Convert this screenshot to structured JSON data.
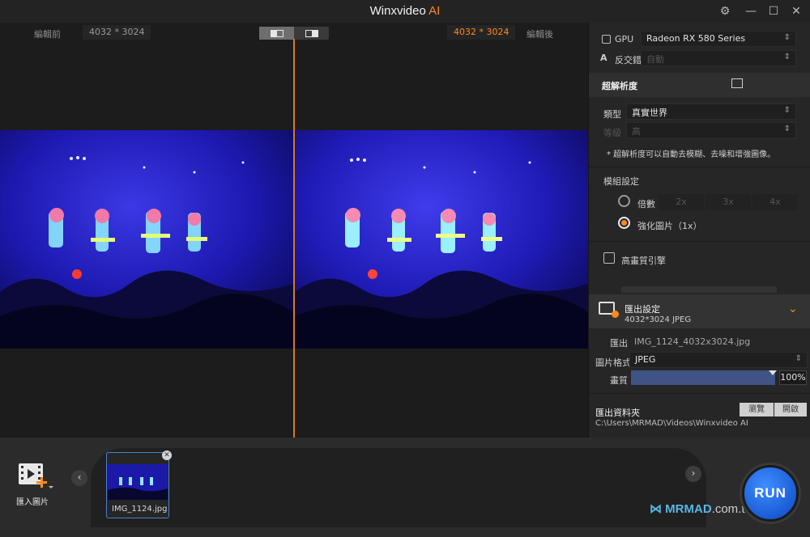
{
  "titlebar": {
    "title_main": "Winxvideo",
    "title_ai": "AI",
    "controls": [
      "gear-icon",
      "minimize-icon",
      "maximize-icon",
      "close-icon"
    ]
  },
  "preview": {
    "before_label": "編輯前",
    "before_resolution": "4032 * 3024",
    "after_resolution": "4032 * 3024",
    "after_label": "編輯後"
  },
  "panel": {
    "gpu_label": "GPU",
    "gpu_value": "Radeon RX 580 Series",
    "anti_alias_label": "反交錯",
    "anti_alias_value": "自動",
    "super_res_title": "超解析度",
    "type_label": "類型",
    "type_value": "真實世界",
    "level_label": "等級",
    "level_value": "高",
    "note": "* 超解析度可以自動去模糊、去噪和增強圖像。",
    "module_title": "模組設定",
    "multiplier_label": "倍數",
    "multipliers": [
      "2x",
      "3x",
      "4x"
    ],
    "enhance_label": "強化圖片（1x）",
    "hq_engine_label": "高畫質引擎",
    "export_title": "匯出設定",
    "export_sub": "4032*3024  JPEG",
    "export_label": "匯出",
    "export_file": "IMG_1124_4032x3024.jpg",
    "format_label": "圖片格式",
    "format_value": "JPEG",
    "quality_label": "畫質",
    "quality_value": "100%",
    "folder_title": "匯出資料夾",
    "browse_label": "瀏覽",
    "open_label": "開啟",
    "folder_path": "C:\\Users\\MRMAD\\Videos\\Winxvideo AI"
  },
  "bottom": {
    "import_label": "匯入圖片",
    "thumb_name": "IMG_1124.jpg",
    "run_label": "RUN",
    "watermark": "MRMAD",
    "watermark_suffix": ".com.tw"
  },
  "colors": {
    "accent": "#ff8a1c",
    "run_blue": "#1f6ff0",
    "stage_blue": "#1a17a8"
  }
}
